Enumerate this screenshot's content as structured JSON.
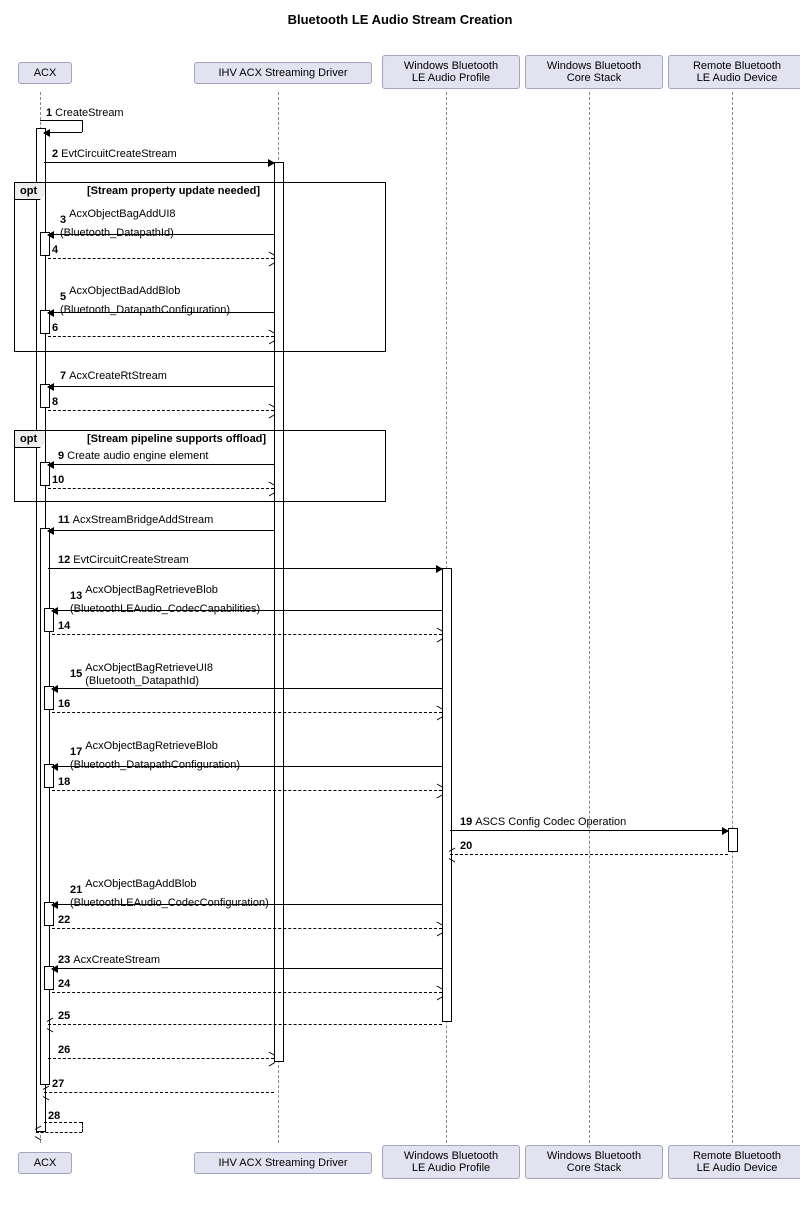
{
  "title": "Bluetooth LE Audio Stream Creation",
  "participants": {
    "p1": "ACX",
    "p2": "IHV ACX Streaming Driver",
    "p3": "Windows Bluetooth\nLE Audio Profile",
    "p4": "Windows Bluetooth\nCore Stack",
    "p5": "Remote Bluetooth\nLE Audio Device"
  },
  "fragments": {
    "f1": {
      "type": "opt",
      "guard": "[Stream property update needed]"
    },
    "f2": {
      "type": "opt",
      "guard": "[Stream pipeline supports offload]"
    }
  },
  "messages": {
    "m1": {
      "n": "1",
      "text": "CreateStream"
    },
    "m2": {
      "n": "2",
      "text": "EvtCircuitCreateStream"
    },
    "m3": {
      "n": "3",
      "text": "AcxObjectBagAddUI8\n(Bluetooth_DatapathId)"
    },
    "m4": {
      "n": "4",
      "text": ""
    },
    "m5": {
      "n": "5",
      "text": "AcxObjectBadAddBlob\n(Bluetooth_DatapathConfiguration)"
    },
    "m6": {
      "n": "6",
      "text": ""
    },
    "m7": {
      "n": "7",
      "text": "AcxCreateRtStream"
    },
    "m8": {
      "n": "8",
      "text": ""
    },
    "m9": {
      "n": "9",
      "text": "Create audio engine element"
    },
    "m10": {
      "n": "10",
      "text": ""
    },
    "m11": {
      "n": "11",
      "text": "AcxStreamBridgeAddStream"
    },
    "m12": {
      "n": "12",
      "text": "EvtCircuitCreateStream"
    },
    "m13": {
      "n": "13",
      "text": "AcxObjectBagRetrieveBlob\n(BluetoothLEAudio_CodecCapabilities)"
    },
    "m14": {
      "n": "14",
      "text": ""
    },
    "m15": {
      "n": "15",
      "text": "AcxObjectBagRetrieveUI8\n(Bluetooth_DatapathId)"
    },
    "m16": {
      "n": "16",
      "text": ""
    },
    "m17": {
      "n": "17",
      "text": "AcxObjectBagRetrieveBlob\n(Bluetooth_DatapathConfiguration)"
    },
    "m18": {
      "n": "18",
      "text": ""
    },
    "m19": {
      "n": "19",
      "text": "ASCS Config Codec Operation"
    },
    "m20": {
      "n": "20",
      "text": ""
    },
    "m21": {
      "n": "21",
      "text": "AcxObjectBagAddBlob\n(BluetoothLEAudio_CodecConfiguration)"
    },
    "m22": {
      "n": "22",
      "text": ""
    },
    "m23": {
      "n": "23",
      "text": "AcxCreateStream"
    },
    "m24": {
      "n": "24",
      "text": ""
    },
    "m25": {
      "n": "25",
      "text": ""
    },
    "m26": {
      "n": "26",
      "text": ""
    },
    "m27": {
      "n": "27",
      "text": ""
    },
    "m28": {
      "n": "28",
      "text": ""
    }
  }
}
